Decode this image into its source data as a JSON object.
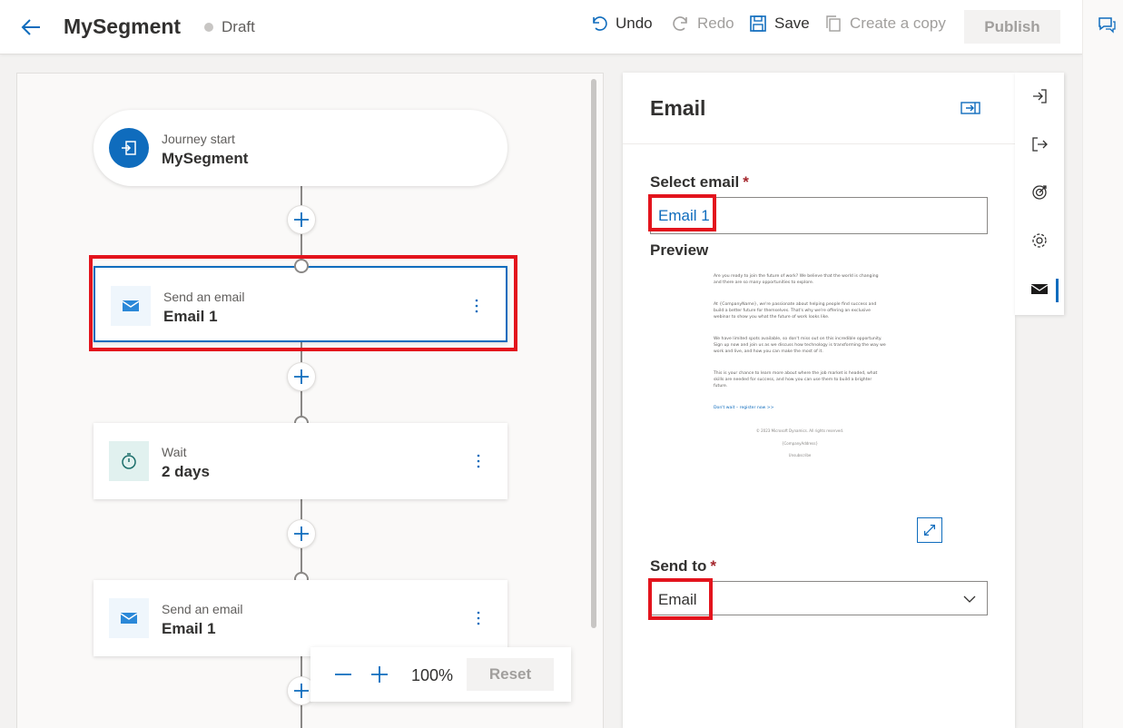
{
  "header": {
    "title": "MySegment",
    "status": "Draft",
    "undo_label": "Undo",
    "redo_label": "Redo",
    "save_label": "Save",
    "copy_label": "Create a copy",
    "publish_label": "Publish"
  },
  "journey": {
    "start": {
      "label": "Journey start",
      "value": "MySegment"
    },
    "tiles": [
      {
        "label": "Send an email",
        "value": "Email 1",
        "icon": "mail-icon"
      },
      {
        "label": "Wait",
        "value": "2 days",
        "icon": "timer-icon"
      },
      {
        "label": "Send an email",
        "value": "Email 1",
        "icon": "mail-icon"
      }
    ]
  },
  "zoom": {
    "level": "100%",
    "reset_label": "Reset"
  },
  "panel": {
    "title": "Email",
    "select_email_label": "Select email",
    "select_email_value": "Email 1",
    "preview_label": "Preview",
    "preview_paragraphs": [
      "Are you ready to join the future of work? We believe that the world is changing and there are so many opportunities to explore.",
      "At {CompanyName}, we're passionate about helping people find success and build a better future for themselves. That's why we're offering an exclusive webinar to show you what the future of work looks like.",
      "We have limited spots available, so don't miss out on this incredible opportunity. Sign up now and join us as we discuss how technology is transforming the way we work and live, and how you can make the most of it.",
      "This is your chance to learn more about where the job market is headed, what skills are needed for success, and how you can use them to build a brighter future.",
      "Don't wait – register now >>"
    ],
    "preview_footer": [
      "© 2023 Microsoft Dynamics. All rights reserved.",
      "{CompanyAddress}",
      "Unsubscribe"
    ],
    "send_to_label": "Send to",
    "send_to_value": "Email"
  },
  "rail": {
    "items": [
      "enter-icon",
      "exit-icon",
      "goal-icon",
      "settings-icon",
      "mail-icon"
    ]
  },
  "colors": {
    "accent": "#0f6cbd",
    "highlight": "#e3141d"
  }
}
